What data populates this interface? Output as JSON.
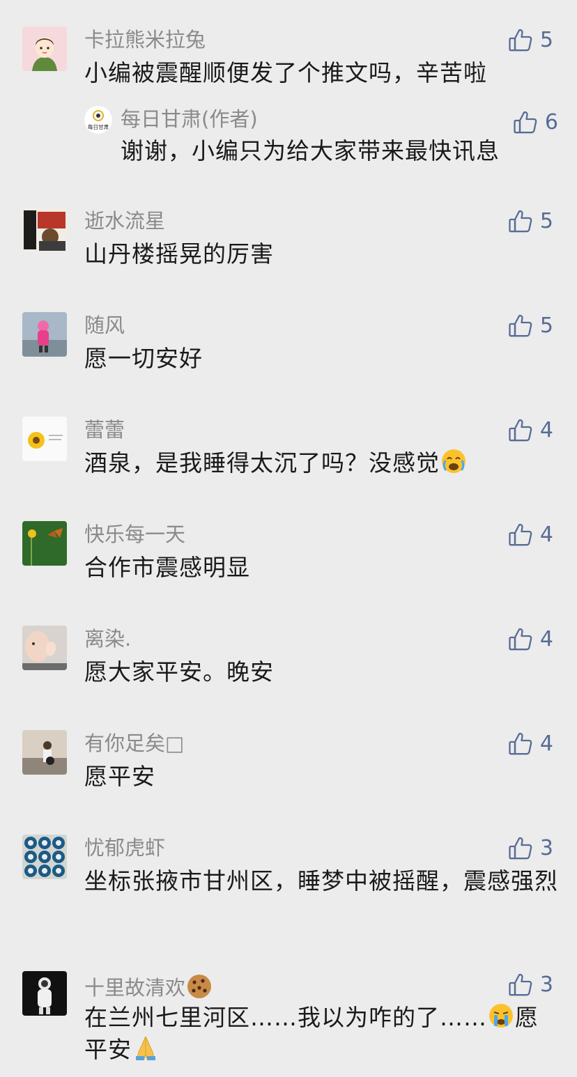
{
  "comments": [
    {
      "name": "卡拉熊米拉兔",
      "text": "小编被震醒顺便发了个推文吗，辛苦啦",
      "likes": "5",
      "avatar": "cartoon-person",
      "reply": {
        "name": "每日甘肃(作者)",
        "text": "谢谢，小编只为给大家带来最快讯息",
        "likes": "6",
        "avatar": "meiri-gansu-logo",
        "logo_text": "每日甘肃"
      }
    },
    {
      "name": "逝水流星",
      "text": "山丹楼摇晃的厉害",
      "likes": "5",
      "avatar": "poster-collage"
    },
    {
      "name": "随风",
      "text": "愿一切安好",
      "likes": "5",
      "avatar": "child-in-pink"
    },
    {
      "name": "蕾蕾",
      "text": "酒泉，是我睡得太沉了吗？没感觉",
      "likes": "4",
      "avatar": "sunflower",
      "emoji_after": "crying-face-emoji"
    },
    {
      "name": "快乐每一天",
      "text": "合作市震感明显",
      "likes": "4",
      "avatar": "butterfly-green"
    },
    {
      "name": "离染.",
      "text": "愿大家平安。晚安",
      "likes": "4",
      "avatar": "child-hand"
    },
    {
      "name": "有你足矣",
      "text": "愿平安",
      "likes": "4",
      "avatar": "person-outdoor",
      "name_suffix": "□"
    },
    {
      "name": "忧郁虎虾",
      "text": "坐标张掖市甘州区，睡梦中被摇醒，震感强烈",
      "likes": "3",
      "avatar": "bottle-caps"
    },
    {
      "name": "十里故清欢",
      "text_part1": "在兰州七里河区……我以为咋的了……",
      "text_part2": "愿平安",
      "likes": "3",
      "avatar": "astronaut",
      "name_emoji": "cookie-emoji",
      "mid_emoji": "crying-emoji",
      "end_emoji": "praying-hands-emoji"
    }
  ],
  "colors": {
    "background": "#ececec",
    "name": "#8a8a8a",
    "text": "#1a1a1a",
    "like": "#576b95"
  }
}
